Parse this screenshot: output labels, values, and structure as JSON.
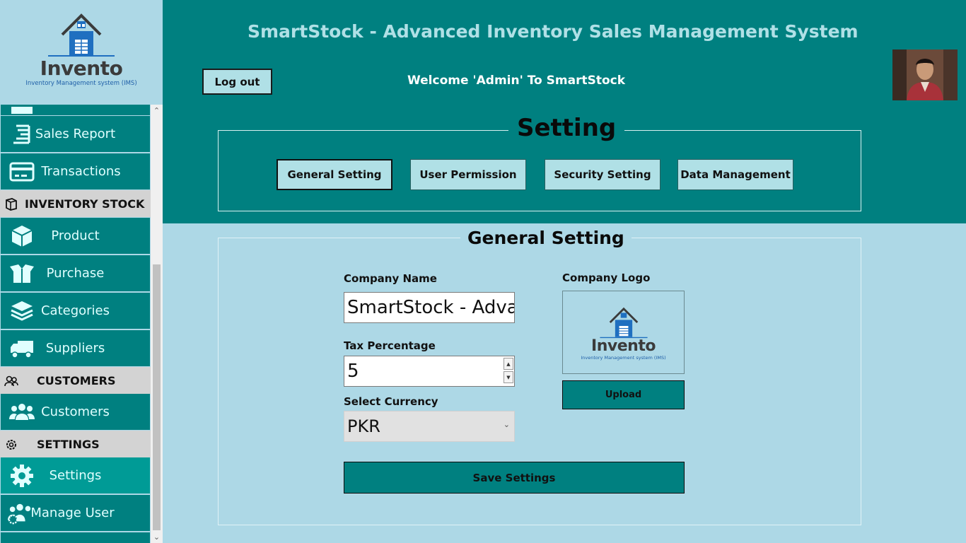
{
  "app": {
    "title": "SmartStock - Advanced Inventory  Sales Management System",
    "welcome": "Welcome 'Admin' To SmartStock",
    "logout_label": "Log out"
  },
  "logo": {
    "word": "Invento",
    "sub": "Inventory Management system (IMS)"
  },
  "sidebar": {
    "items": [
      {
        "label": "Sales Report",
        "icon": "report-icon"
      },
      {
        "label": "Transactions",
        "icon": "card-icon"
      },
      {
        "label": "Product",
        "icon": "box-icon"
      },
      {
        "label": "Purchase",
        "icon": "open-box-icon"
      },
      {
        "label": "Categories",
        "icon": "layers-icon"
      },
      {
        "label": "Suppliers",
        "icon": "truck-icon"
      },
      {
        "label": "Customers",
        "icon": "users-icon"
      },
      {
        "label": "Settings",
        "icon": "gear-icon"
      },
      {
        "label": "Manage User",
        "icon": "users-gear-icon"
      }
    ],
    "headers": [
      {
        "label": "INVENTORY  STOCK"
      },
      {
        "label": "CUSTOMERS"
      },
      {
        "label": "SETTINGS"
      }
    ],
    "active": "Settings"
  },
  "setting": {
    "title": "Setting",
    "tabs": [
      {
        "label": "General Setting"
      },
      {
        "label": "User Permission"
      },
      {
        "label": "Security Setting"
      },
      {
        "label": "Data Management"
      }
    ],
    "selected_tab": "General Setting"
  },
  "general": {
    "title": "General Setting",
    "company_name_label": "Company Name",
    "company_name_value": "SmartStock - Advar",
    "tax_label": "Tax Percentage",
    "tax_value": "5",
    "currency_label": "Select Currency",
    "currency_value": "PKR",
    "logo_label": "Company Logo",
    "upload_label": "Upload",
    "save_label": "Save Settings"
  },
  "colors": {
    "teal": "#008080",
    "light_blue": "#add8e6",
    "powder": "#b0e0e6"
  }
}
